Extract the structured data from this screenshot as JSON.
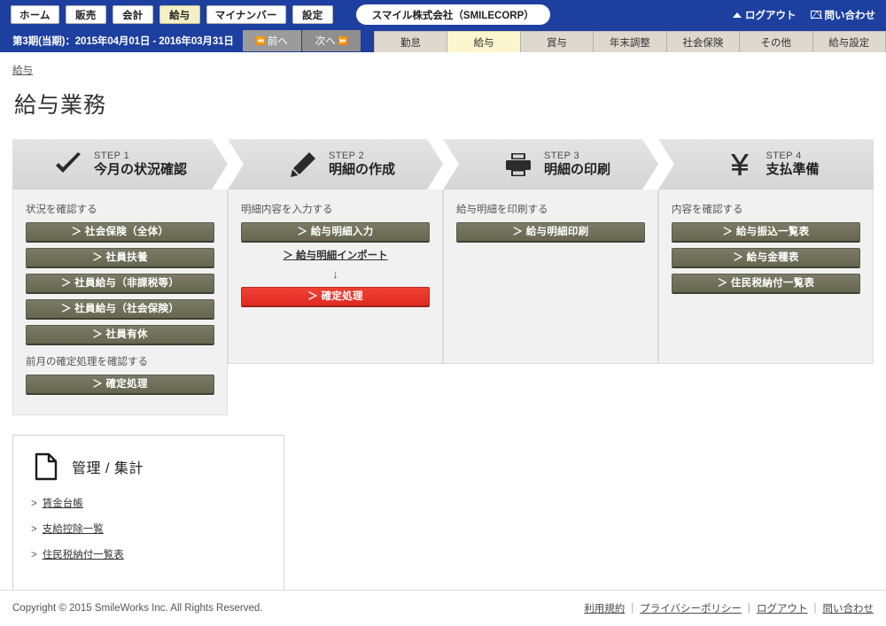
{
  "topbar": {
    "main_tabs": [
      {
        "label": "ホーム",
        "active": false
      },
      {
        "label": "販売",
        "active": false
      },
      {
        "label": "会計",
        "active": false
      },
      {
        "label": "給与",
        "active": true
      },
      {
        "label": "マイナンバー",
        "active": false
      },
      {
        "label": "設定",
        "active": false
      }
    ],
    "company": "スマイル株式会社（SMILECORP）",
    "logout": "ログアウト",
    "contact": "問い合わせ",
    "bg_color": "#1d3fa0",
    "active_tab_color": "#f4f0c6"
  },
  "subbar": {
    "period": "第3期(当期)：2015年04月01日 - 2016年03月31日",
    "prev": "前へ",
    "next": "次へ",
    "tabs": [
      {
        "label": "勤怠",
        "active": false
      },
      {
        "label": "給与",
        "active": true
      },
      {
        "label": "賞与",
        "active": false
      },
      {
        "label": "年末調整",
        "active": false
      },
      {
        "label": "社会保険",
        "active": false
      },
      {
        "label": "その他",
        "active": false
      },
      {
        "label": "給与設定",
        "active": false
      }
    ],
    "active_tab_color": "#fbf6cd"
  },
  "breadcrumb": "給与",
  "page_title": "給与業務",
  "steps": [
    {
      "num": "STEP 1",
      "title": "今月の状況確認",
      "icon": "check-icon",
      "label": "状況を確認する",
      "buttons": [
        "＞ 社会保険（全体）",
        "＞ 社員扶養",
        "＞ 社員給与（非課税等）",
        "＞ 社員給与（社会保険）",
        "＞ 社員有休"
      ],
      "label2": "前月の確定処理を確認する",
      "buttons2": [
        "＞ 確定処理"
      ]
    },
    {
      "num": "STEP 2",
      "title": "明細の作成",
      "icon": "pencil-icon",
      "label": "明細内容を入力する",
      "buttons": [
        "＞ 給与明細入力"
      ],
      "import_link": "＞ 給与明細インポート",
      "arrow": "↓",
      "confirm_button": "＞ 確定処理",
      "confirm_color": "#e8342a"
    },
    {
      "num": "STEP 3",
      "title": "明細の印刷",
      "icon": "printer-icon",
      "label": "給与明細を印刷する",
      "buttons": [
        "＞ 給与明細印刷"
      ]
    },
    {
      "num": "STEP 4",
      "title": "支払準備",
      "icon": "yen-icon",
      "label": "内容を確認する",
      "buttons": [
        "＞ 給与振込一覧表",
        "＞ 給与金種表",
        "＞ 住民税納付一覧表"
      ]
    }
  ],
  "management": {
    "title": "管理 / 集計",
    "icon": "document-icon",
    "links": [
      "賃金台帳",
      "支給控除一覧",
      "住民税納付一覧表"
    ]
  },
  "footer": {
    "copyright": "Copyright © 2015 SmileWorks Inc. All Rights Reserved.",
    "links": [
      "利用規約",
      "プライバシーポリシー",
      "ログアウト",
      "問い合わせ"
    ]
  }
}
